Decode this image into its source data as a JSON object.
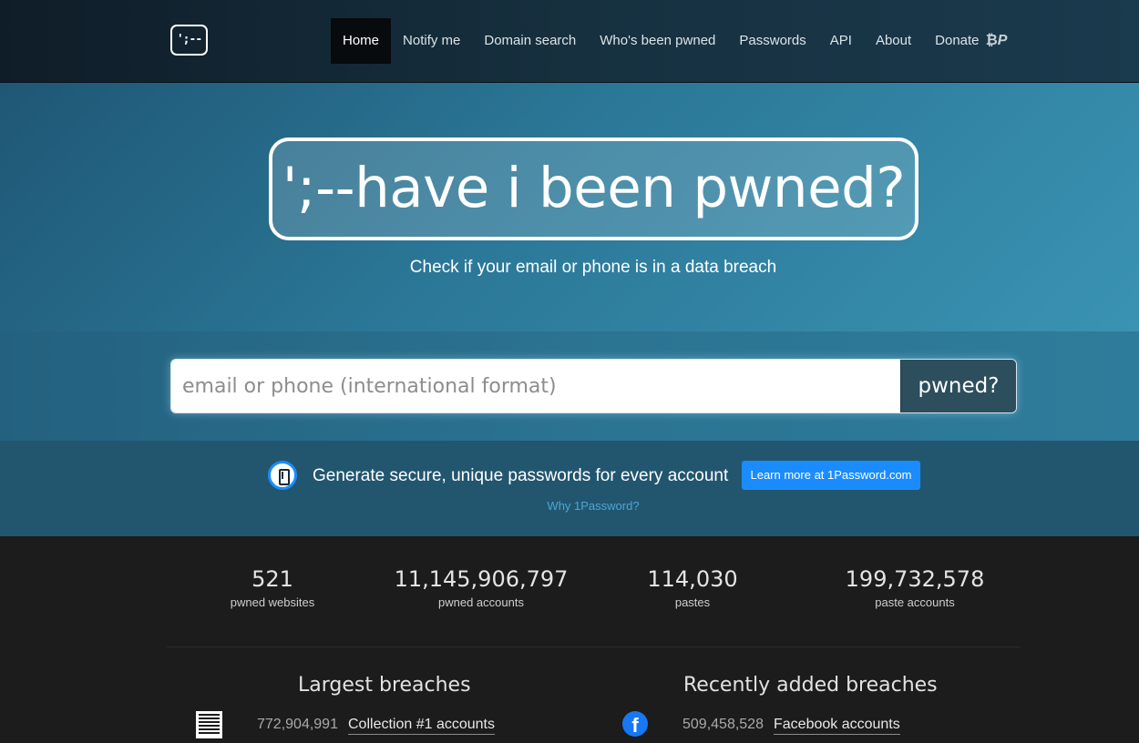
{
  "navbar": {
    "logo_text": "';--",
    "items": [
      {
        "label": "Home",
        "active": true
      },
      {
        "label": "Notify me",
        "active": false
      },
      {
        "label": "Domain search",
        "active": false
      },
      {
        "label": "Who's been pwned",
        "active": false
      },
      {
        "label": "Passwords",
        "active": false
      },
      {
        "label": "API",
        "active": false
      },
      {
        "label": "About",
        "active": false
      },
      {
        "label": "Donate",
        "active": false
      }
    ],
    "donate_icons": [
      "bitcoin-icon",
      "paypal-icon"
    ]
  },
  "hero": {
    "title": "';--have i been pwned?",
    "subtitle": "Check if your email or phone is in a data breach"
  },
  "search": {
    "placeholder": "email or phone (international format)",
    "value": "",
    "button_label": "pwned?"
  },
  "promo": {
    "text": "Generate secure, unique passwords for every account",
    "button_label": "Learn more at 1Password.com",
    "link_label": "Why 1Password?",
    "accent_color": "#1a8cff"
  },
  "stats": [
    {
      "value": "521",
      "label": "pwned websites"
    },
    {
      "value": "11,145,906,797",
      "label": "pwned accounts"
    },
    {
      "value": "114,030",
      "label": "pastes"
    },
    {
      "value": "199,732,578",
      "label": "paste accounts"
    }
  ],
  "largest_breaches": {
    "title": "Largest breaches",
    "items": [
      {
        "count": "772,904,991",
        "name": "Collection #1 accounts",
        "icon": "document-icon"
      }
    ]
  },
  "recent_breaches": {
    "title": "Recently added breaches",
    "items": [
      {
        "count": "509,458,528",
        "name": "Facebook accounts",
        "icon": "facebook-icon"
      }
    ]
  }
}
